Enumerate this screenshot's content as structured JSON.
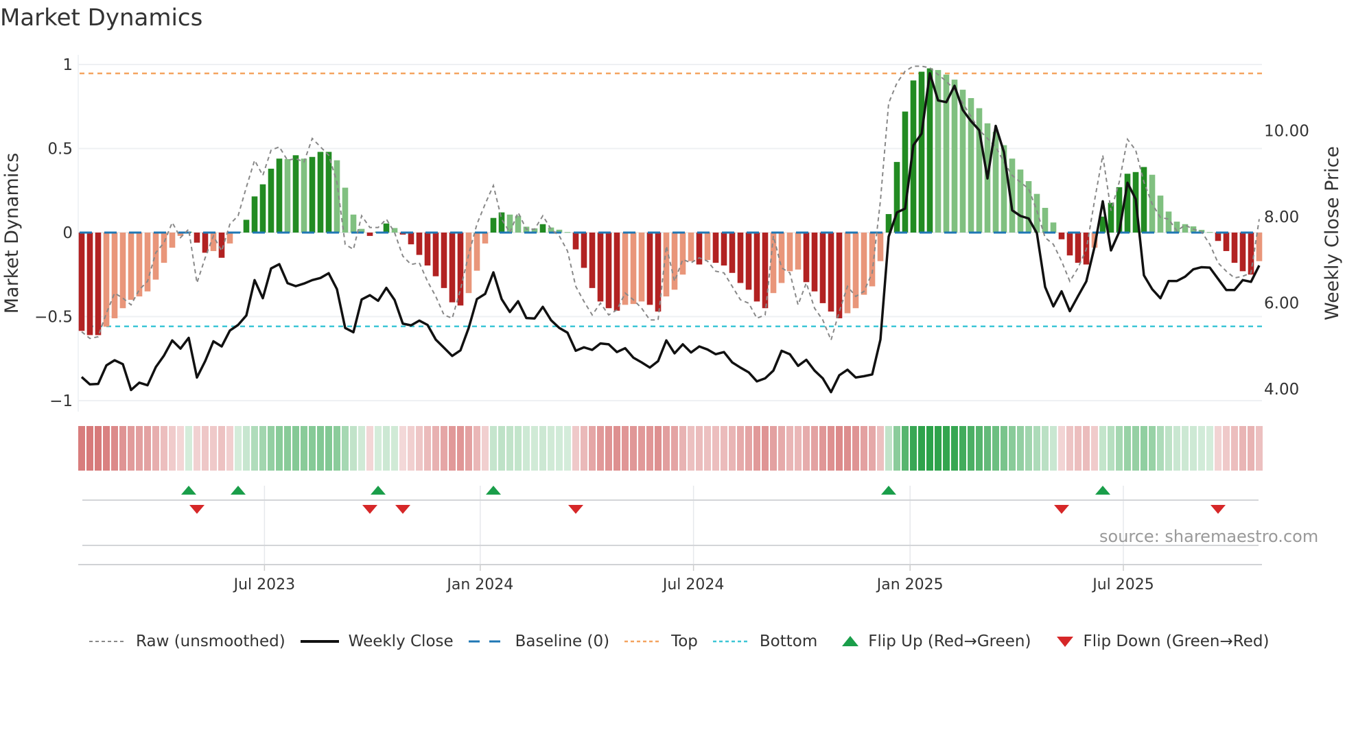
{
  "chart_data": {
    "type": "bar",
    "title": "Market Dynamics",
    "ylabel": "Market Dynamics",
    "y2label": "Weekly Close Price",
    "ylim": [
      -1.1,
      1.05
    ],
    "y_ticks": [
      {
        "v": 1,
        "label": "1"
      },
      {
        "v": 0.5,
        "label": "0.5"
      },
      {
        "v": 0,
        "label": "0"
      },
      {
        "v": -0.5,
        "label": "−0.5"
      },
      {
        "v": -1,
        "label": "−1"
      }
    ],
    "y2_ticks": [
      {
        "v": 10,
        "label": "10.00"
      },
      {
        "v": 8,
        "label": "8.00"
      },
      {
        "v": 6,
        "label": "6.00"
      },
      {
        "v": 4,
        "label": "4.00"
      }
    ],
    "x_ticks": [
      {
        "week": 23.2,
        "label": "Jul 2023"
      },
      {
        "week": 49.4,
        "label": "Jan 2024"
      },
      {
        "week": 75.3,
        "label": "Jul 2024"
      },
      {
        "week": 101.6,
        "label": "Jan 2025"
      },
      {
        "week": 127.5,
        "label": "Jul 2025"
      }
    ],
    "top_level": 0.947,
    "bottom_level": -0.558,
    "baseline": 0,
    "dynamics": [
      -0.585,
      -0.61,
      -0.61,
      -0.56,
      -0.51,
      -0.45,
      -0.4,
      -0.38,
      -0.35,
      -0.28,
      -0.18,
      -0.09,
      -0.02,
      0.005,
      -0.06,
      -0.12,
      -0.11,
      -0.15,
      -0.065,
      0.005,
      0.076,
      0.215,
      0.287,
      0.38,
      0.44,
      0.437,
      0.46,
      0.44,
      0.45,
      0.48,
      0.48,
      0.43,
      0.267,
      0.107,
      0.022,
      -0.02,
      0.005,
      0.054,
      0.027,
      -0.012,
      -0.07,
      -0.133,
      -0.196,
      -0.26,
      -0.33,
      -0.415,
      -0.434,
      -0.36,
      -0.227,
      -0.065,
      0.087,
      0.12,
      0.107,
      0.1,
      0.035,
      0.025,
      0.05,
      0.03,
      0.017,
      0.003,
      -0.1,
      -0.21,
      -0.33,
      -0.41,
      -0.45,
      -0.465,
      -0.43,
      -0.425,
      -0.41,
      -0.43,
      -0.47,
      -0.38,
      -0.34,
      -0.25,
      -0.17,
      -0.19,
      -0.163,
      -0.18,
      -0.196,
      -0.24,
      -0.3,
      -0.34,
      -0.41,
      -0.45,
      -0.36,
      -0.3,
      -0.23,
      -0.22,
      -0.295,
      -0.35,
      -0.42,
      -0.47,
      -0.51,
      -0.48,
      -0.45,
      -0.37,
      -0.32,
      -0.17,
      0.11,
      0.42,
      0.72,
      0.905,
      0.957,
      0.977,
      0.967,
      0.94,
      0.91,
      0.85,
      0.8,
      0.74,
      0.65,
      0.6,
      0.52,
      0.44,
      0.375,
      0.306,
      0.23,
      0.147,
      0.06,
      -0.04,
      -0.136,
      -0.18,
      -0.19,
      -0.09,
      0.095,
      0.177,
      0.27,
      0.35,
      0.36,
      0.39,
      0.344,
      0.22,
      0.125,
      0.065,
      0.05,
      0.037,
      0.016,
      0.003,
      -0.05,
      -0.11,
      -0.18,
      -0.23,
      -0.25,
      -0.17
    ],
    "raw": [
      -0.59,
      -0.63,
      -0.62,
      -0.48,
      -0.36,
      -0.39,
      -0.43,
      -0.34,
      -0.29,
      -0.12,
      -0.06,
      0.06,
      -0.03,
      0.02,
      -0.3,
      -0.15,
      -0.02,
      -0.11,
      0.05,
      0.1,
      0.27,
      0.43,
      0.34,
      0.49,
      0.51,
      0.43,
      0.44,
      0.42,
      0.56,
      0.51,
      0.46,
      0.3,
      -0.07,
      -0.1,
      0.1,
      0.03,
      0.03,
      0.08,
      0,
      -0.14,
      -0.19,
      -0.18,
      -0.29,
      -0.38,
      -0.49,
      -0.51,
      -0.34,
      -0.13,
      0.05,
      0.17,
      0.28,
      0.08,
      0,
      0.12,
      0.02,
      0.02,
      0.1,
      0.02,
      -0.02,
      -0.11,
      -0.32,
      -0.41,
      -0.49,
      -0.42,
      -0.49,
      -0.46,
      -0.36,
      -0.4,
      -0.45,
      -0.52,
      -0.52,
      -0.08,
      -0.29,
      -0.16,
      -0.18,
      -0.15,
      -0.17,
      -0.23,
      -0.24,
      -0.32,
      -0.4,
      -0.42,
      -0.51,
      -0.49,
      -0.02,
      -0.21,
      -0.24,
      -0.43,
      -0.3,
      -0.45,
      -0.52,
      -0.64,
      -0.47,
      -0.32,
      -0.38,
      -0.35,
      -0.24,
      0.19,
      0.77,
      0.89,
      0.96,
      0.99,
      0.99,
      0.98,
      0.94,
      0.9,
      0.85,
      0.77,
      0.69,
      0.61,
      0.56,
      0.51,
      0.42,
      0.34,
      0.3,
      0.26,
      0.13,
      -0.03,
      -0.07,
      -0.17,
      -0.29,
      -0.21,
      -0.1,
      0.19,
      0.46,
      0.13,
      0.3,
      0.555,
      0.49,
      0.3,
      0.17,
      0.09,
      0.08,
      0.01,
      0.045,
      0.02,
      0.005,
      -0.07,
      -0.18,
      -0.23,
      -0.27,
      -0.26,
      -0.24,
      0.08
    ],
    "weekly_close": [
      4.28,
      4.11,
      4.12,
      4.55,
      4.67,
      4.58,
      3.98,
      4.15,
      4.09,
      4.51,
      4.78,
      5.13,
      4.94,
      5.19,
      4.27,
      4.65,
      5.11,
      4.99,
      5.36,
      5.49,
      5.71,
      6.53,
      6.11,
      6.8,
      6.9,
      6.46,
      6.39,
      6.45,
      6.53,
      6.58,
      6.69,
      6.32,
      5.42,
      5.32,
      6.08,
      6.18,
      6.05,
      6.35,
      6.07,
      5.52,
      5.48,
      5.59,
      5.49,
      5.15,
      4.96,
      4.77,
      4.9,
      5.42,
      6.09,
      6.21,
      6.71,
      6.09,
      5.79,
      6.04,
      5.65,
      5.64,
      5.91,
      5.6,
      5.42,
      5.31,
      4.89,
      4.97,
      4.91,
      5.06,
      5.04,
      4.86,
      4.95,
      4.73,
      4.62,
      4.5,
      4.65,
      5.13,
      4.83,
      5.04,
      4.85,
      4.99,
      4.92,
      4.81,
      4.86,
      4.62,
      4.5,
      4.39,
      4.18,
      4.25,
      4.43,
      4.89,
      4.81,
      4.54,
      4.68,
      4.43,
      4.25,
      3.93,
      4.32,
      4.45,
      4.27,
      4.3,
      4.34,
      5.15,
      7.54,
      8.1,
      8.19,
      9.66,
      9.93,
      11.33,
      10.7,
      10.66,
      11.04,
      10.48,
      10.22,
      10.01,
      8.89,
      10.11,
      9.5,
      8.15,
      8.02,
      7.96,
      7.62,
      6.37,
      5.92,
      6.27,
      5.81,
      6.16,
      6.5,
      7.3,
      8.36,
      7.22,
      7.65,
      8.79,
      8.41,
      6.64,
      6.32,
      6.11,
      6.51,
      6.51,
      6.61,
      6.78,
      6.83,
      6.82,
      6.56,
      6.3,
      6.3,
      6.53,
      6.49,
      6.87
    ],
    "legend": {
      "placement": "bottom",
      "items": [
        {
          "key": "raw",
          "label": "Raw (unsmoothed)"
        },
        {
          "key": "close",
          "label": "Weekly Close"
        },
        {
          "key": "baseline",
          "label": "Baseline (0)"
        },
        {
          "key": "top",
          "label": "Top"
        },
        {
          "key": "bottom",
          "label": "Bottom"
        },
        {
          "key": "flip_up",
          "label": "Flip Up (Red→Green)"
        },
        {
          "key": "flip_down",
          "label": "Flip Down (Green→Red)"
        }
      ]
    },
    "annotation": "source: sharemaestro.com",
    "colors": {
      "strong_pos": "#228b22",
      "weak_pos": "#80c080",
      "strong_neg": "#b22222",
      "weak_neg": "#e9967a",
      "baseline": "#1f77b4",
      "top": "#f4a460",
      "bottom": "#3ec6d6",
      "raw": "#888888",
      "close": "#111111",
      "flip_up": "#1a9e4a",
      "flip_down": "#d62728"
    }
  }
}
